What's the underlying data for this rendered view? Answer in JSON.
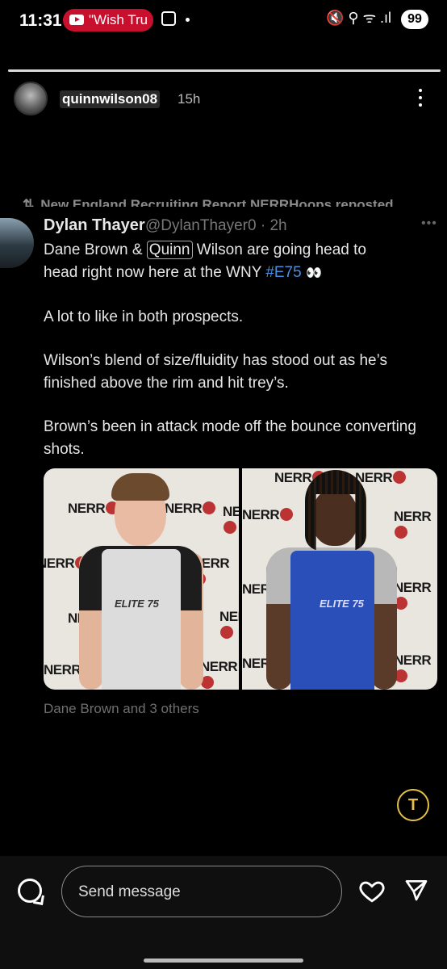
{
  "status_bar": {
    "time": "11:31",
    "media_pill": "\"Wish Tru",
    "icons": "🔇 ⚲ ᯤ .ıl",
    "battery": "99"
  },
  "story": {
    "progress_fraction": 1.0,
    "username": "quinnwilson08",
    "time_ago": "15h"
  },
  "tweet": {
    "reposted_by": "New England Recruiting Report NERRHoops reposted",
    "author_name": "Dylan Thayer",
    "author_handle": "@DylanThayer0",
    "separator": " · ",
    "time": "2h",
    "more": "•••",
    "line1_a": "Dane Brown & ",
    "line1_highlight": "Quinn",
    "line1_b": " Wilson are going head to",
    "line2_a": "head right now here at the WNY ",
    "line2_tag": "#E75",
    "line2_emoji": "👀",
    "para2": "A lot to like in both prospects.",
    "para3": "Wilson’s blend of size/fluidity has stood out as he’s finished above the rim and hit trey’s.",
    "para4": "Brown’s been in attack mode off the bounce converting shots.",
    "tagged": "Dane Brown and 3 others",
    "backdrop_logo": "NERR",
    "jersey_text": "ELITE 75"
  },
  "translate_button": "T",
  "bottom_bar": {
    "message_placeholder": "Send message"
  },
  "colors": {
    "background": "#000000",
    "hashtag": "#4a8fe0",
    "translate_accent": "#e4c04a",
    "youtube_red": "#c8102e",
    "jersey_blue": "#2a4fb8"
  }
}
